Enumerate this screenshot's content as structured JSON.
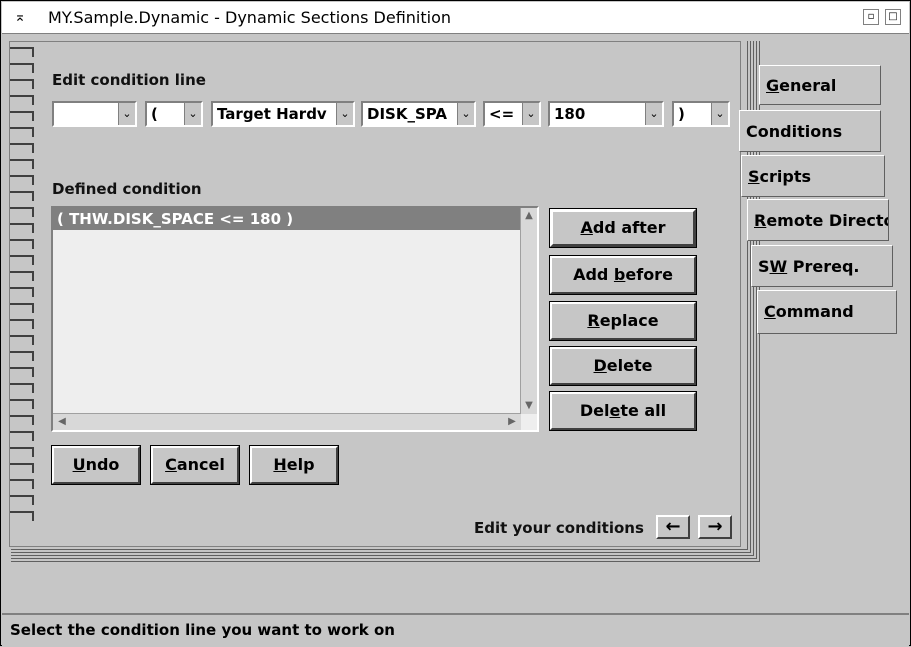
{
  "window": {
    "title": "MY.Sample.Dynamic - Dynamic Sections Definition"
  },
  "edit_condition": {
    "label": "Edit condition line",
    "combos": [
      {
        "value": "",
        "name": "connector-combo"
      },
      {
        "value": "(",
        "name": "open-paren-combo"
      },
      {
        "value": "Target Hardv",
        "name": "category-combo"
      },
      {
        "value": "DISK_SPA",
        "name": "attribute-combo"
      },
      {
        "value": "<=",
        "name": "operator-combo"
      },
      {
        "value": "180",
        "name": "value-combo"
      },
      {
        "value": ")",
        "name": "close-paren-combo"
      }
    ]
  },
  "defined_condition": {
    "label": "Defined condition",
    "items": [
      "( THW.DISK_SPACE <= 180 )"
    ]
  },
  "buttons": {
    "add_after": {
      "pre": "",
      "u": "A",
      "post": "dd after"
    },
    "add_before": {
      "pre": "Add ",
      "u": "b",
      "post": "efore"
    },
    "replace": {
      "pre": "",
      "u": "R",
      "post": "eplace"
    },
    "delete": {
      "pre": "",
      "u": "D",
      "post": "elete"
    },
    "delete_all": {
      "pre": "Del",
      "u": "e",
      "post": "te all"
    },
    "undo": {
      "pre": "",
      "u": "U",
      "post": "ndo"
    },
    "cancel": {
      "pre": "",
      "u": "C",
      "post": "ancel"
    },
    "help": {
      "pre": "",
      "u": "H",
      "post": "elp"
    }
  },
  "tabs": {
    "general": {
      "pre": "",
      "u": "G",
      "post": "eneral"
    },
    "conditions": {
      "text": "Conditions"
    },
    "scripts": {
      "pre": "",
      "u": "S",
      "post": "cripts"
    },
    "remote": {
      "pre": "",
      "u": "R",
      "post": "emote Directo"
    },
    "swprereq": {
      "pre": "S",
      "u": "W",
      "post": " Prereq."
    },
    "command": {
      "pre": "",
      "u": "C",
      "post": "ommand"
    }
  },
  "page_nav": {
    "label": "Edit your conditions",
    "prev": "←",
    "next": "→"
  },
  "status": {
    "text": "Select the condition line you want to work on"
  }
}
